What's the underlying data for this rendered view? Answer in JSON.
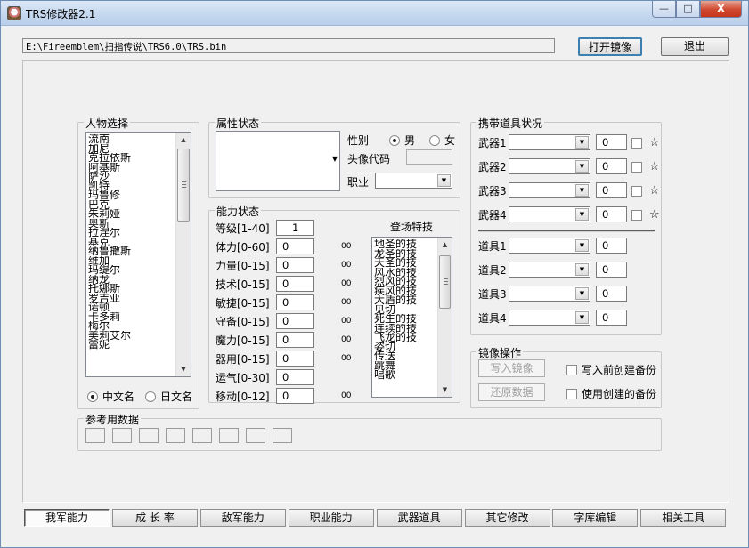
{
  "window": {
    "title": "TRS修改器2.1",
    "min": "—",
    "max": "□",
    "close": "X"
  },
  "toolbar": {
    "path": "E:\\Fireemblem\\扫指传说\\TRS6.0\\TRS.bin",
    "open_label": "打开镜像",
    "exit_label": "退出"
  },
  "character": {
    "title": "人物选择",
    "items": [
      "流南",
      "加尼",
      "克拉依斯",
      "阿基斯",
      "萨沙",
      "凯特",
      "玛鲁修",
      "巴克",
      "朱莉娅",
      "奥斯",
      "拉涅尔",
      "基克",
      "纳鲁撒斯",
      "维加",
      "玛缇尔",
      "纳龙",
      "托娜斯",
      "罗吉亚",
      "诺顿",
      "卡多莉",
      "梅尔",
      "美莉艾尔",
      "蕾妮"
    ],
    "lang_cn": "中文名",
    "lang_jp": "日文名",
    "lang_selected": "cn"
  },
  "attributes": {
    "title": "属性状态",
    "gender_label": "性别",
    "male": "男",
    "female": "女",
    "gender_selected": "male",
    "portrait_label": "头像代码",
    "class_label": "职业"
  },
  "ability": {
    "title": "能力状态",
    "rows": [
      {
        "label": "等级[1-40]",
        "value": "1",
        "hex": ""
      },
      {
        "label": "体力[0-60]",
        "value": "0",
        "hex": "00"
      },
      {
        "label": "力量[0-15]",
        "value": "0",
        "hex": "00"
      },
      {
        "label": "技术[0-15]",
        "value": "0",
        "hex": "00"
      },
      {
        "label": "敏捷[0-15]",
        "value": "0",
        "hex": "00"
      },
      {
        "label": "守备[0-15]",
        "value": "0",
        "hex": "00"
      },
      {
        "label": "魔力[0-15]",
        "value": "0",
        "hex": "00"
      },
      {
        "label": "器用[0-15]",
        "value": "0",
        "hex": "00"
      },
      {
        "label": "运气[0-30]",
        "value": "0",
        "hex": ""
      },
      {
        "label": "移动[0-12]",
        "value": "0",
        "hex": "00"
      }
    ],
    "skills_title": "登场特技",
    "skills": [
      "地圣的技",
      "龙圣的技",
      "天圣的技",
      "风水的技",
      "烈风的技",
      "疾风的技",
      "大盾的技",
      "见切",
      "死生的技",
      "连续的技",
      "飞龙的技",
      "姿切",
      "传送",
      "跳舞",
      "唱歌"
    ]
  },
  "items": {
    "title": "携带道具状况",
    "weapons": [
      {
        "label": "武器1",
        "value": "0"
      },
      {
        "label": "武器2",
        "value": "0"
      },
      {
        "label": "武器3",
        "value": "0"
      },
      {
        "label": "武器4",
        "value": "0"
      }
    ],
    "star": "☆",
    "tools": [
      {
        "label": "道具1",
        "value": "0"
      },
      {
        "label": "道具2",
        "value": "0"
      },
      {
        "label": "道具3",
        "value": "0"
      },
      {
        "label": "道具4",
        "value": "0"
      }
    ]
  },
  "image_ops": {
    "title": "镜像操作",
    "write_label": "写入镜像",
    "restore_label": "还原数据",
    "backup_before": "写入前创建备份",
    "use_backup": "使用创建的备份"
  },
  "reference": {
    "title": "参考用数据"
  },
  "tabs": [
    "我军能力",
    "成 长 率",
    "敌军能力",
    "职业能力",
    "武器道具",
    "其它修改",
    "字库编辑",
    "相关工具"
  ],
  "active_tab": 0
}
